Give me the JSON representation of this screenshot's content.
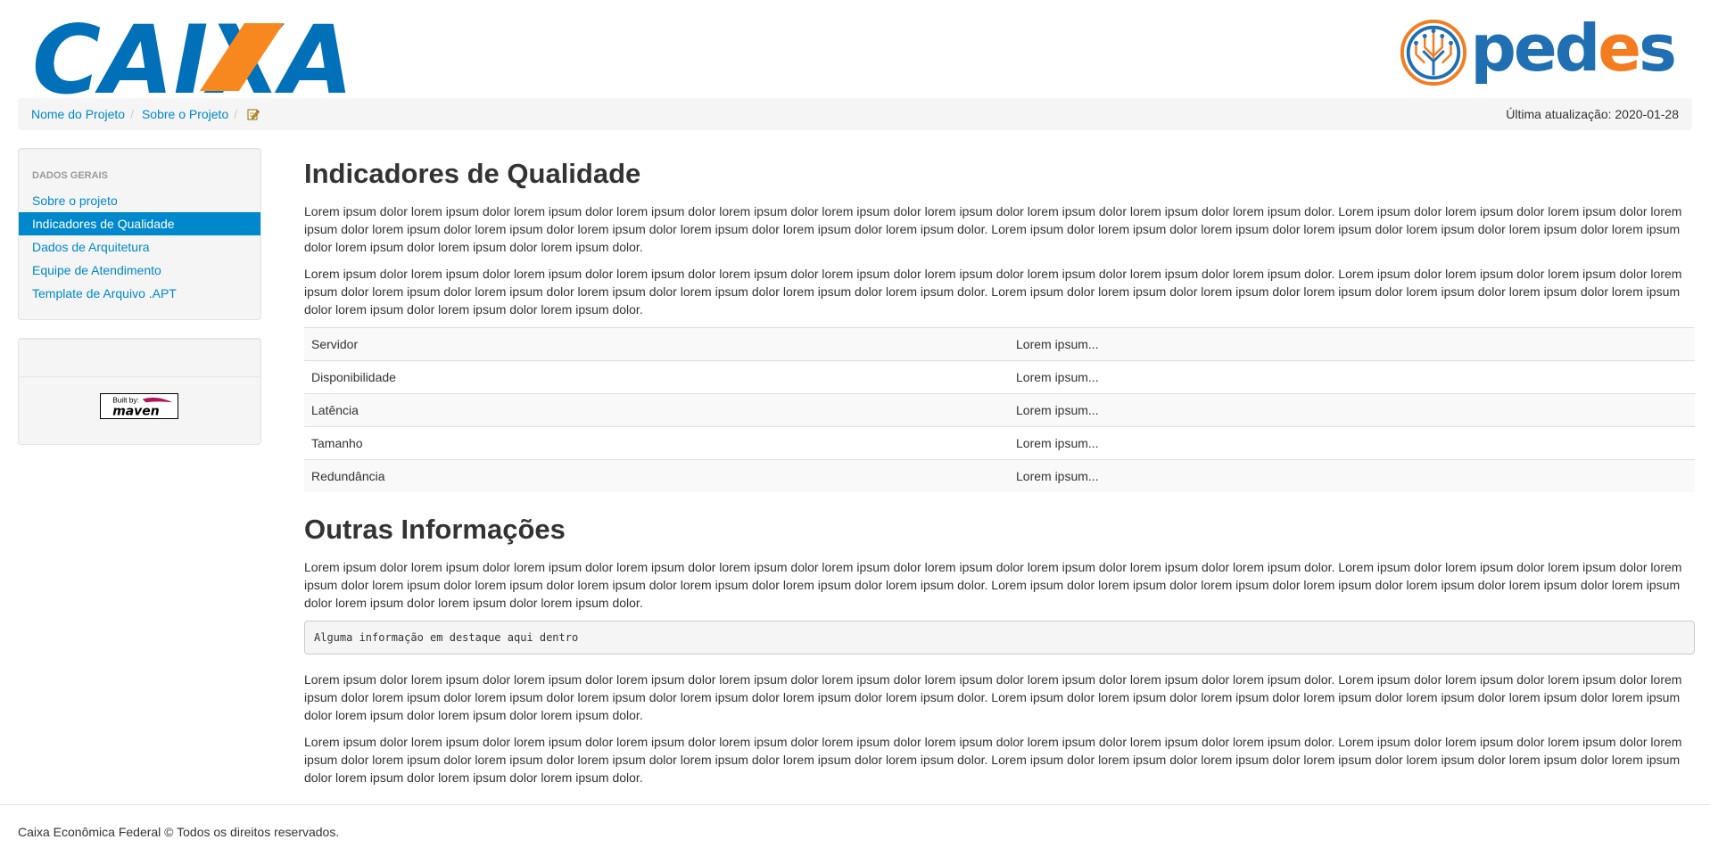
{
  "header": {
    "caixa_logo": "CAIXA",
    "pedes_logo": {
      "prefix": "ped",
      "accent": "e",
      "suffix": "s"
    },
    "colors": {
      "caixa_blue": "#0070b8",
      "caixa_orange": "#f7881f",
      "pedes_blue": "#1f6fb2",
      "pedes_orange": "#f47c20"
    }
  },
  "breadcrumb": {
    "items": [
      "Nome do Projeto",
      "Sobre o Projeto"
    ],
    "edit_icon": "edit-icon",
    "last_updated": "Última atualização: 2020-01-28"
  },
  "sidebar": {
    "header": "DADOS GERAIS",
    "items": [
      {
        "label": "Sobre o projeto"
      },
      {
        "label": "Indicadores de Qualidade"
      },
      {
        "label": "Dados de Arquitetura"
      },
      {
        "label": "Equipe de Atendimento"
      },
      {
        "label": "Template de Arquivo .APT"
      }
    ],
    "active_index": 1,
    "badge": {
      "line1": "Built by:",
      "line2": "maven"
    }
  },
  "main": {
    "title1": "Indicadores de Qualidade",
    "p1": "Lorem ipsum dolor lorem ipsum dolor lorem ipsum dolor lorem ipsum dolor lorem ipsum dolor lorem ipsum dolor lorem ipsum dolor lorem ipsum dolor lorem ipsum dolor lorem ipsum dolor. Lorem ipsum dolor lorem ipsum dolor lorem ipsum dolor lorem ipsum dolor lorem ipsum dolor lorem ipsum dolor lorem ipsum dolor lorem ipsum dolor lorem ipsum dolor lorem ipsum dolor. Lorem ipsum dolor lorem ipsum dolor lorem ipsum dolor lorem ipsum dolor lorem ipsum dolor lorem ipsum dolor lorem ipsum dolor lorem ipsum dolor lorem ipsum dolor lorem ipsum dolor.",
    "p2": "Lorem ipsum dolor lorem ipsum dolor lorem ipsum dolor lorem ipsum dolor lorem ipsum dolor lorem ipsum dolor lorem ipsum dolor lorem ipsum dolor lorem ipsum dolor lorem ipsum dolor. Lorem ipsum dolor lorem ipsum dolor lorem ipsum dolor lorem ipsum dolor lorem ipsum dolor lorem ipsum dolor lorem ipsum dolor lorem ipsum dolor lorem ipsum dolor lorem ipsum dolor. Lorem ipsum dolor lorem ipsum dolor lorem ipsum dolor lorem ipsum dolor lorem ipsum dolor lorem ipsum dolor lorem ipsum dolor lorem ipsum dolor lorem ipsum dolor lorem ipsum dolor.",
    "table": [
      {
        "key": "Servidor",
        "value": "Lorem ipsum..."
      },
      {
        "key": "Disponibilidade",
        "value": "Lorem ipsum..."
      },
      {
        "key": "Latência",
        "value": "Lorem ipsum..."
      },
      {
        "key": "Tamanho",
        "value": "Lorem ipsum..."
      },
      {
        "key": "Redundância",
        "value": "Lorem ipsum..."
      }
    ],
    "title2": "Outras Informações",
    "p3": "Lorem ipsum dolor lorem ipsum dolor lorem ipsum dolor lorem ipsum dolor lorem ipsum dolor lorem ipsum dolor lorem ipsum dolor lorem ipsum dolor lorem ipsum dolor lorem ipsum dolor. Lorem ipsum dolor lorem ipsum dolor lorem ipsum dolor lorem ipsum dolor lorem ipsum dolor lorem ipsum dolor lorem ipsum dolor lorem ipsum dolor lorem ipsum dolor lorem ipsum dolor. Lorem ipsum dolor lorem ipsum dolor lorem ipsum dolor lorem ipsum dolor lorem ipsum dolor lorem ipsum dolor lorem ipsum dolor lorem ipsum dolor lorem ipsum dolor lorem ipsum dolor.",
    "code": "Alguma informação em destaque aqui dentro",
    "p4": "Lorem ipsum dolor lorem ipsum dolor lorem ipsum dolor lorem ipsum dolor lorem ipsum dolor lorem ipsum dolor lorem ipsum dolor lorem ipsum dolor lorem ipsum dolor lorem ipsum dolor. Lorem ipsum dolor lorem ipsum dolor lorem ipsum dolor lorem ipsum dolor lorem ipsum dolor lorem ipsum dolor lorem ipsum dolor lorem ipsum dolor lorem ipsum dolor lorem ipsum dolor. Lorem ipsum dolor lorem ipsum dolor lorem ipsum dolor lorem ipsum dolor lorem ipsum dolor lorem ipsum dolor lorem ipsum dolor lorem ipsum dolor lorem ipsum dolor lorem ipsum dolor.",
    "p5": "Lorem ipsum dolor lorem ipsum dolor lorem ipsum dolor lorem ipsum dolor lorem ipsum dolor lorem ipsum dolor lorem ipsum dolor lorem ipsum dolor lorem ipsum dolor lorem ipsum dolor. Lorem ipsum dolor lorem ipsum dolor lorem ipsum dolor lorem ipsum dolor lorem ipsum dolor lorem ipsum dolor lorem ipsum dolor lorem ipsum dolor lorem ipsum dolor lorem ipsum dolor. Lorem ipsum dolor lorem ipsum dolor lorem ipsum dolor lorem ipsum dolor lorem ipsum dolor lorem ipsum dolor lorem ipsum dolor lorem ipsum dolor lorem ipsum dolor lorem ipsum dolor."
  },
  "footer": {
    "text": "Caixa Econômica Federal © Todos os direitos reservados."
  }
}
